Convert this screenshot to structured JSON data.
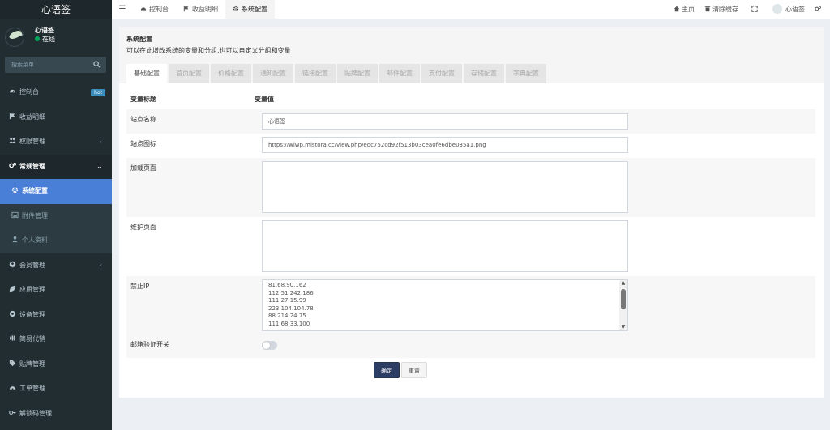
{
  "brand": "心语签",
  "user": {
    "name": "心语签",
    "status": "在线"
  },
  "search": {
    "placeholder": "搜索菜单"
  },
  "menu": [
    {
      "label": "控制台",
      "icon": "dashboard-icon",
      "badge": "hot"
    },
    {
      "label": "收益明细",
      "icon": "flag-icon"
    },
    {
      "label": "权限管理",
      "icon": "group-icon",
      "arrow": "‹"
    },
    {
      "label": "常规管理",
      "icon": "cogs-icon",
      "arrow": "⌄"
    },
    {
      "label": "系统配置",
      "icon": "gear-icon"
    },
    {
      "label": "附件管理",
      "icon": "image-icon"
    },
    {
      "label": "个人资料",
      "icon": "user-icon"
    },
    {
      "label": "会员管理",
      "icon": "user-circle-icon",
      "arrow": "‹"
    },
    {
      "label": "应用管理",
      "icon": "leaf-icon"
    },
    {
      "label": "设备管理",
      "icon": "circle-icon"
    },
    {
      "label": "简易代销",
      "icon": "globe-icon"
    },
    {
      "label": "贴牌管理",
      "icon": "tag-icon"
    },
    {
      "label": "工单管理",
      "icon": "gauge-icon"
    },
    {
      "label": "解锁码管理",
      "icon": "key-icon"
    }
  ],
  "navbar": {
    "tabs": [
      {
        "label": "控制台",
        "icon": "dashboard-icon"
      },
      {
        "label": "收益明细",
        "icon": "flag-icon"
      },
      {
        "label": "系统配置",
        "icon": "gear-icon"
      }
    ],
    "right": {
      "home": "主页",
      "clear_cache": "清除缓存",
      "username": "心语签"
    }
  },
  "panel": {
    "title": "系统配置",
    "description": "可以在此增改系统的变量和分组,也可以自定义分组和变量",
    "tabs": [
      "基础配置",
      "首页配置",
      "价格配置",
      "通知配置",
      "链接配置",
      "贴牌配置",
      "邮件配置",
      "支付配置",
      "存储配置",
      "字典配置"
    ]
  },
  "table": {
    "col_title": "变量标题",
    "col_value": "变量值",
    "site_name": {
      "label": "站点名称",
      "value": "心语签"
    },
    "site_icon": {
      "label": "站点图标",
      "value": "https://wlwp.mistora.cc/view.php/edc752cd92f513b03cea0fe6dbe035a1.png"
    },
    "loading_page": {
      "label": "加载页面",
      "value": ""
    },
    "maintenance_page": {
      "label": "维护页面",
      "value": ""
    },
    "banned_ip": {
      "label": "禁止IP",
      "lines": [
        "81.68.90.162",
        "112.51.242.186",
        "111.27.15.99",
        "223.104.104.78",
        "88.214.24.75",
        "111.68.33.100"
      ]
    },
    "email_verify": {
      "label": "邮箱验证开关"
    }
  },
  "buttons": {
    "confirm": "确定",
    "reset": "重置"
  },
  "colors": {
    "sidebar": "#222d32",
    "active": "#4a7fd8",
    "primary": "#2c3e63",
    "online": "#00a65a"
  }
}
